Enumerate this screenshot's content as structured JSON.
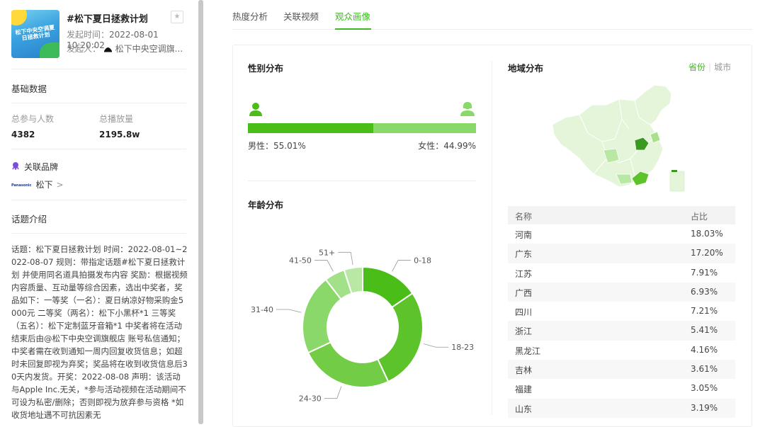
{
  "topic": {
    "thumbnail_text": "松下中央空调夏日拯救计划",
    "title": "#松下夏日拯救计划",
    "start_label": "发起时间：",
    "start_time": "2022-08-01 10:20:02",
    "initiator_label": "发起人：",
    "initiator": "松下中央空调旗..."
  },
  "basic": {
    "heading": "基础数据",
    "participants_label": "总参与人数",
    "participants_value": "4382",
    "plays_label": "总播放量",
    "plays_value": "2195.8w"
  },
  "brand": {
    "heading": "关联品牌",
    "logo_text": "Panasonic",
    "name": "松下",
    "arrow": ">"
  },
  "intro": {
    "heading": "话题介绍",
    "text": "话题：松下夏日拯救计划 时间：2022-08-01~2022-08-07 规则：带指定话题#松下夏日拯救计划 并使用同名道具拍摄发布内容 奖励：根据视频内容质量、互动量等综合因素，选出中奖者，奖品如下：一等奖（一名）：夏日纳凉好物采购金5000元 二等奖（两名）：松下小黑杯*1 三等奖（五名）：松下定制蓝牙音箱*1 中奖者将在活动结束后由@松下中央空调旗舰店 账号私信通知；中奖者需在收到通知一周内回复收货信息；如超时未回复即视为弃奖；奖品将在收到收货信息后30天内发货。开奖：2022-08-08 声明：该活动与Apple Inc.无关，*参与活动视频在活动期间不可设为私密/删除；否则即视为放弃参与资格 *如收货地址遇不可抗因素无"
  },
  "tabs": [
    "热度分析",
    "关联视频",
    "观众画像"
  ],
  "active_tab": 2,
  "gender": {
    "heading": "性别分布",
    "male_label": "男性：55.01%",
    "female_label": "女性：44.99%",
    "male_pct": 55.01,
    "female_pct": 44.99,
    "male_color": "#4bbd18",
    "female_color": "#8ad86a"
  },
  "age": {
    "heading": "年龄分布"
  },
  "chart_data": {
    "type": "pie",
    "donut": true,
    "categories": [
      "0-18",
      "18-23",
      "24-30",
      "31-40",
      "41-50",
      "51+"
    ],
    "values": [
      15.5,
      27.5,
      25.0,
      21.5,
      5.5,
      5.0
    ],
    "colors": [
      "#4bbd18",
      "#5cc42a",
      "#72cc45",
      "#8ad86a",
      "#a3e08a",
      "#b8e8a4"
    ]
  },
  "region": {
    "heading": "地域分布",
    "tab_province": "省份",
    "tab_city": "城市",
    "col_name": "名称",
    "col_share": "占比",
    "rows": [
      {
        "name": "河南",
        "share": "18.03%"
      },
      {
        "name": "广东",
        "share": "17.20%"
      },
      {
        "name": "江苏",
        "share": "7.91%"
      },
      {
        "name": "广西",
        "share": "6.93%"
      },
      {
        "name": "四川",
        "share": "7.21%"
      },
      {
        "name": "浙江",
        "share": "5.41%"
      },
      {
        "name": "黑龙江",
        "share": "4.16%"
      },
      {
        "name": "吉林",
        "share": "3.61%"
      },
      {
        "name": "福建",
        "share": "3.05%"
      },
      {
        "name": "山东",
        "share": "3.19%"
      }
    ]
  },
  "colors": {
    "accent": "#3dba1f",
    "map_base": "#e4f5da",
    "map_highlight": "#3a9a1e"
  }
}
